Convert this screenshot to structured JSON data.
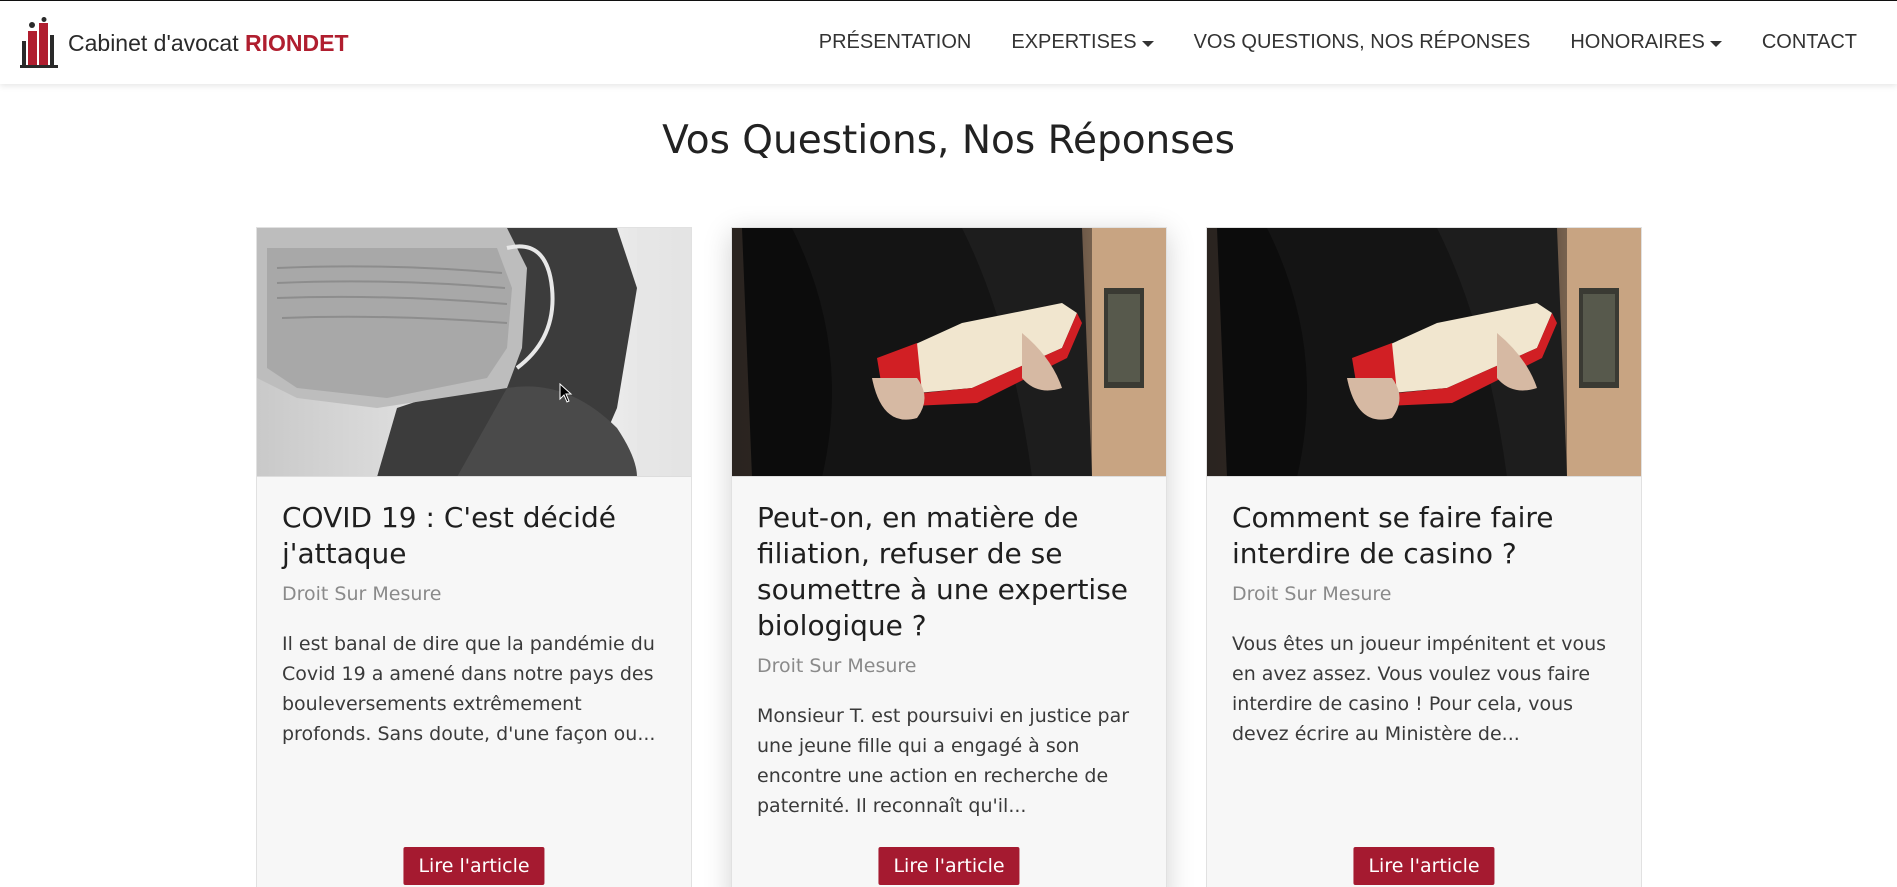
{
  "brand": {
    "text_prefix": "Cabinet d'avocat ",
    "text_name": "RIONDET",
    "logo_icon": "firm-logo-icon"
  },
  "nav": {
    "items": [
      {
        "label": "PRÉSENTATION",
        "dropdown": false
      },
      {
        "label": "EXPERTISES",
        "dropdown": true
      },
      {
        "label": "VOS QUESTIONS, NOS RÉPONSES",
        "dropdown": false
      },
      {
        "label": "HONORAIRES",
        "dropdown": true
      },
      {
        "label": "CONTACT",
        "dropdown": false
      }
    ]
  },
  "page": {
    "title": "Vos Questions, Nos Réponses"
  },
  "articles": [
    {
      "title": "COVID 19 : C'est décidé j'attaque",
      "author": "Droit Sur Mesure",
      "excerpt": "Il est banal de dire que la pandémie du Covid 19 a amené dans notre pays des bouleversements extrêmement profonds. Sans doute, d'une façon ou...",
      "button": "Lire l'article",
      "image_icon": "masked-person-photo"
    },
    {
      "title": "Peut-on, en matière de filiation, refuser de se soumettre à une expertise biologique ?",
      "author": "Droit Sur Mesure",
      "excerpt": "Monsieur T. est poursuivi en justice par une jeune fille qui a engagé à son encontre une action en recherche de paternité. Il reconnaît qu'il...",
      "button": "Lire l'article",
      "image_icon": "lawyer-red-book-photo"
    },
    {
      "title": "Comment se faire faire interdire de casino ?",
      "author": "Droit Sur Mesure",
      "excerpt": "Vous êtes un joueur impénitent et vous en avez assez. Vous voulez vous faire interdire de casino ! Pour cela, vous devez écrire au Ministère de...",
      "button": "Lire l'article",
      "image_icon": "lawyer-red-book-photo"
    }
  ],
  "colors": {
    "accent": "#a51a30",
    "brand_red": "#b01e2f",
    "card_bg": "#f7f7f7"
  }
}
